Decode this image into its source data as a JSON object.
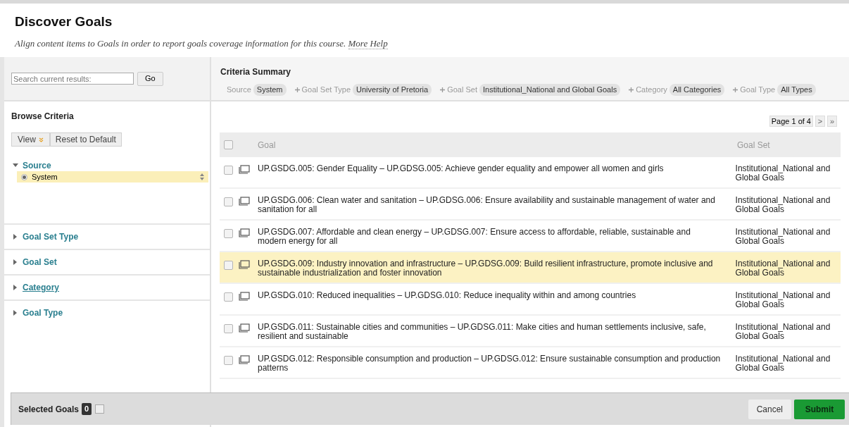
{
  "header": {
    "title": "Discover Goals",
    "description": "Align content items to Goals in order to report goals coverage information for this course.",
    "help_link": "More Help"
  },
  "search": {
    "placeholder": "Search current results:",
    "button": "Go"
  },
  "browse": {
    "title": "Browse Criteria",
    "view_button": "View",
    "reset_button": "Reset to Default",
    "sections": [
      {
        "label": "Source",
        "expanded": true,
        "underlined": false,
        "options": [
          {
            "label": "System",
            "selected": true
          }
        ]
      },
      {
        "label": "Goal Set Type",
        "expanded": false,
        "underlined": false
      },
      {
        "label": "Goal Set",
        "expanded": false,
        "underlined": false
      },
      {
        "label": "Category",
        "expanded": false,
        "underlined": true
      },
      {
        "label": "Goal Type",
        "expanded": false,
        "underlined": false
      }
    ]
  },
  "summary": {
    "title": "Criteria Summary",
    "criteria": [
      {
        "label": "Source",
        "value": "System",
        "plus": false
      },
      {
        "label": "Goal Set Type",
        "value": "University of Pretoria",
        "plus": true
      },
      {
        "label": "Goal Set",
        "value": "Institutional_National and Global Goals",
        "plus": true
      },
      {
        "label": "Category",
        "value": "All Categories",
        "plus": true
      },
      {
        "label": "Goal Type",
        "value": "All Types",
        "plus": true
      }
    ]
  },
  "pagination": {
    "label": "Page 1 of 4",
    "next": ">",
    "last": "»"
  },
  "table": {
    "columns": [
      "Goal",
      "Goal Set"
    ],
    "select_all_checked": false,
    "rows": [
      {
        "goal": "UP.GSDG.005: Gender Equality – UP.GDSG.005: Achieve gender equality and empower all women and girls",
        "goal_set": "Institutional_National and Global Goals",
        "checked": false,
        "highlighted": false
      },
      {
        "goal": "UP.GSDG.006: Clean water and sanitation – UP.GDSG.006: Ensure availability and sustainable management of water and sanitation for all",
        "goal_set": "Institutional_National and Global Goals",
        "checked": false,
        "highlighted": false
      },
      {
        "goal": "UP.GSDG.007: Affordable and clean energy – UP.GDSG.007: Ensure access to affordable, reliable, sustainable and modern energy for all",
        "goal_set": "Institutional_National and Global Goals",
        "checked": false,
        "highlighted": false
      },
      {
        "goal": "UP.GSDG.009: Industry innovation and infrastructure – UP.GDSG.009: Build resilient infrastructure, promote inclusive and sustainable industrialization and foster innovation",
        "goal_set": "Institutional_National and Global Goals",
        "checked": false,
        "highlighted": true
      },
      {
        "goal": "UP.GSDG.010: Reduced inequalities – UP.GDSG.010: Reduce inequality within and among countries",
        "goal_set": "Institutional_National and Global Goals",
        "checked": false,
        "highlighted": false
      },
      {
        "goal": "UP.GSDG.011: Sustainable cities and communities – UP.GDSG.011: Make cities and human settlements inclusive, safe, resilient and sustainable",
        "goal_set": "Institutional_National and Global Goals",
        "checked": false,
        "highlighted": false
      },
      {
        "goal": "UP.GSDG.012: Responsible consumption and production – UP.GDSG.012: Ensure sustainable consumption and production patterns",
        "goal_set": "Institutional_National and Global Goals",
        "checked": false,
        "highlighted": false
      }
    ]
  },
  "footer": {
    "label": "Selected Goals",
    "count": "0",
    "cancel": "Cancel",
    "submit": "Submit"
  }
}
